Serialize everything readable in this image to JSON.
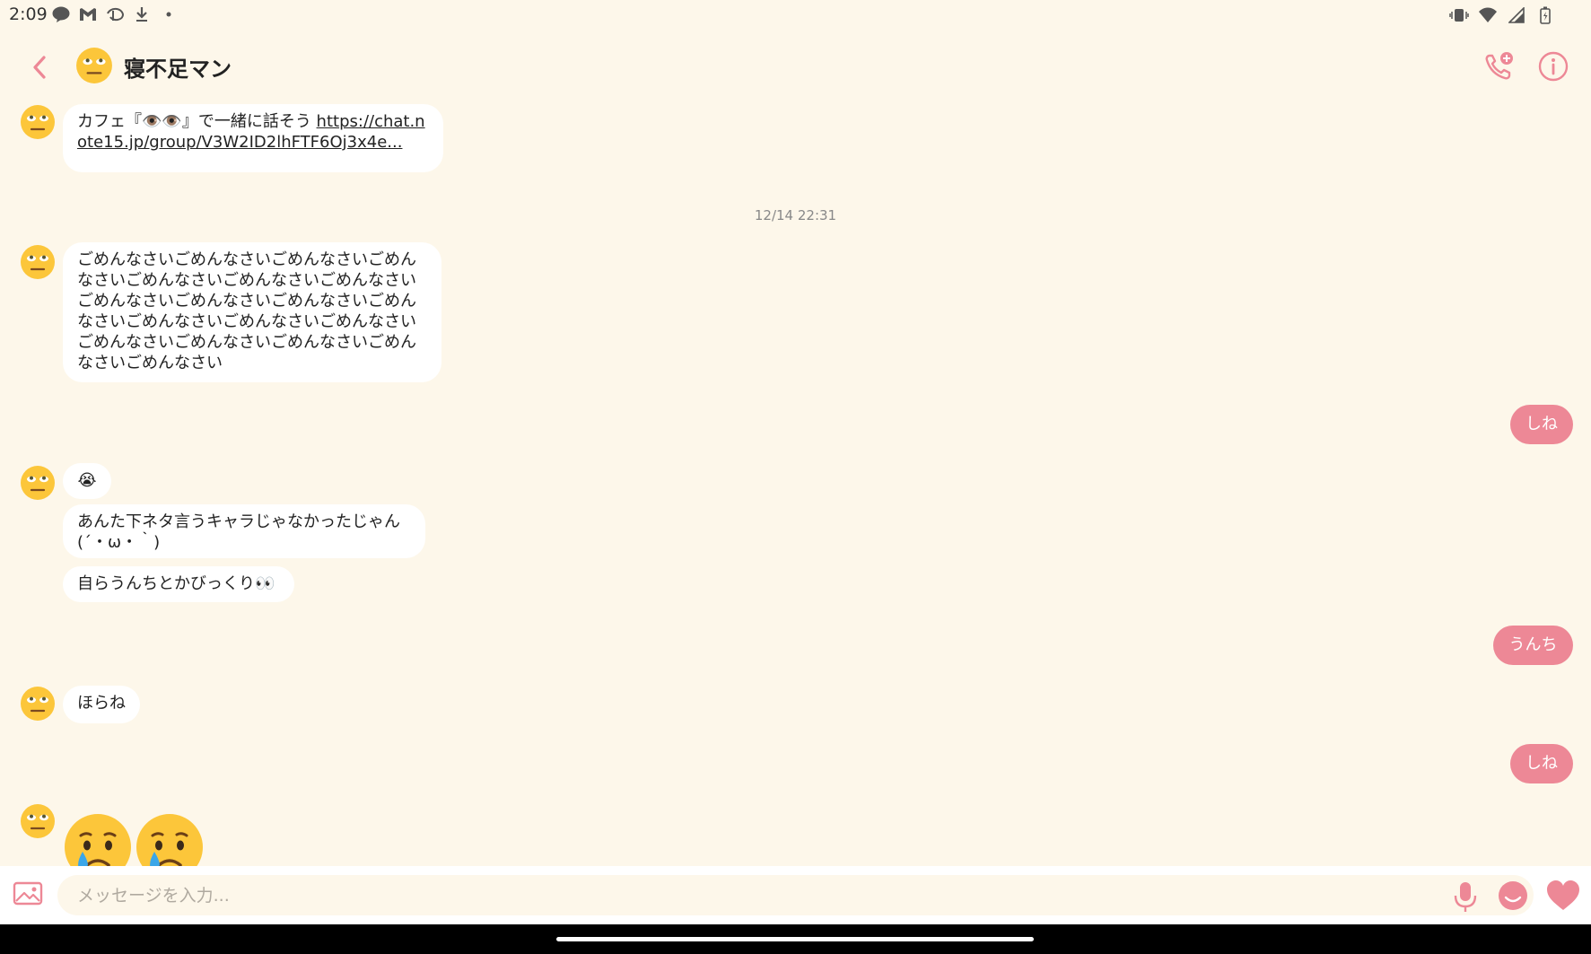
{
  "status_bar": {
    "time": "2:09",
    "left_icons": [
      "line-icon",
      "gmail-icon",
      "disney-plus-icon",
      "download-icon",
      "dot-icon"
    ],
    "right_icons": [
      "vibrate-icon",
      "wifi-icon",
      "signal-icon",
      "battery-icon"
    ]
  },
  "header": {
    "title": "寝不足マン",
    "avatar": "rolling-eyes-face"
  },
  "messages": {
    "m1_text": "カフェ『👁️👁️』で一緒に話そう ",
    "m1_link": "https://chat.note15.jp/group/V3W2ID2lhFTF6Oj3x4e...",
    "timestamp": "12/14 22:31",
    "m2_text": "ごめんなさいごめんなさいごめんなさいごめんなさいごめんなさいごめんなさいごめんなさいごめんなさいごめんなさいごめんなさいごめんなさいごめんなさいごめんなさいごめんなさいごめんなさいごめんなさいごめんなさいごめんなさいごめんなさい",
    "s1_text": "しね",
    "m3_text": "😭",
    "m4_text": "あんた下ネタ言うキャラじゃなかったじゃん(´・ω・｀)",
    "m5_text": "自らうんちとかびっくり👀",
    "s2_text": "うんち",
    "m6_text": "ほらね",
    "s3_text": "しね",
    "m7_emojis": "😢😢"
  },
  "input": {
    "placeholder": "メッセージを入力..."
  },
  "colors": {
    "background": "#fdf7ea",
    "accent": "#ed8896",
    "bubble": "#ffffff"
  }
}
